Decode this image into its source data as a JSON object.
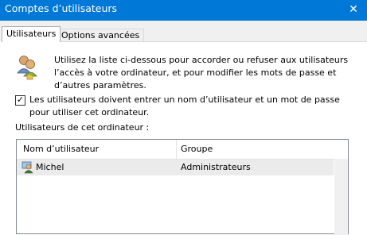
{
  "window": {
    "title": "Comptes d’utilisateurs",
    "close_glyph": "✕"
  },
  "tabs": [
    {
      "label": "Utilisateurs",
      "active": true
    },
    {
      "label": "Options avancées",
      "active": false
    }
  ],
  "intro": {
    "icon": "users-icon",
    "text": "Utilisez la liste ci-dessous pour accorder ou refuser aux utilisateurs l’accès à votre ordinateur, et pour modifier les mots de passe et d’autres paramètres."
  },
  "require_password": {
    "checked": true,
    "check_glyph": "✓",
    "label": "Les utilisateurs doivent entrer un nom d’utilisateur et un mot de passe pour utiliser cet ordinateur."
  },
  "users_list": {
    "label": "Utilisateurs de cet ordinateur :",
    "columns": [
      "Nom d’utilisateur",
      "Groupe"
    ],
    "rows": [
      {
        "icon": "user-admin-icon",
        "name": "Michel",
        "group": "Administrateurs",
        "selected": true
      }
    ]
  },
  "colors": {
    "titlebar": "#0078d7",
    "selected_row": "#ebebeb"
  }
}
